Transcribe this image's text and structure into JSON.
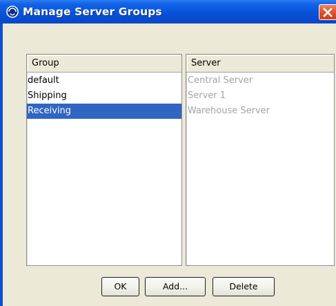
{
  "dialog": {
    "title": "Manage Server Groups",
    "icon": "app-logo-icon",
    "close_icon": "close-icon"
  },
  "group_list": {
    "header": "Group",
    "items": [
      "default",
      "Shipping",
      "Receiving"
    ],
    "selected": "Receiving"
  },
  "server_list": {
    "header": "Server",
    "items": [
      "Central Server",
      "Server 1",
      "Warehouse Server"
    ]
  },
  "buttons": {
    "ok": "OK",
    "add": "Add...",
    "delete": "Delete"
  },
  "colors": {
    "titlebar": "#0a52d8",
    "dialog_background": "#ece9d8",
    "selection": "#3165c4",
    "disabled_text": "#a3a3a3",
    "close_button": "#e2552e"
  }
}
